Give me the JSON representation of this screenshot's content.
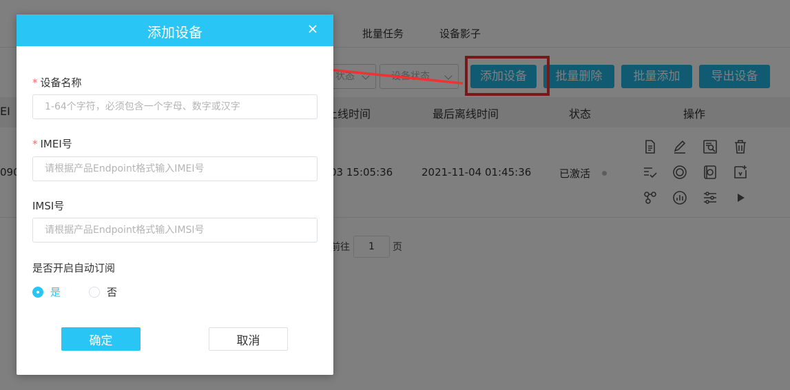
{
  "tabs": [
    "批量任务",
    "设备影子"
  ],
  "filters": {
    "partial_select": "状态",
    "status_select": "设备状态"
  },
  "toolbar": {
    "add_device": "添加设备",
    "batch_delete": "批量删除",
    "batch_add": "批量添加",
    "export_device": "导出设备"
  },
  "table": {
    "headers": [
      "EI",
      "上线时间",
      "最后离线时间",
      "状态",
      "操作"
    ],
    "row": {
      "imei_partial": "090",
      "online_time": "03 15:05:36",
      "last_offline_time": "2021-11-04 01:45:36",
      "status": "已激活"
    },
    "operation_icons": [
      "document-icon",
      "edit-icon",
      "search-detail-icon",
      "delete-icon",
      "checklist-icon",
      "target-icon",
      "data-icon",
      "star-add-icon",
      "nodes-icon",
      "chart-icon",
      "settings-sliders-icon",
      "play-icon"
    ]
  },
  "pager": {
    "goto_label": "前往",
    "page": "1",
    "page_unit": "页"
  },
  "dialog": {
    "title": "添加设备",
    "device_name_label": "设备名称",
    "device_name_placeholder": "1-64个字符，必须包含一个字母、数字或汉字",
    "imei_label": "IMEI号",
    "imei_placeholder": "请根据产品Endpoint格式输入IMEI号",
    "imsi_label": "IMSI号",
    "imsi_placeholder": "请根据产品Endpoint格式输入IMSI号",
    "auto_subscribe_label": "是否开启自动订阅",
    "option_yes": "是",
    "option_no": "否",
    "confirm_label": "确定",
    "cancel_label": "取消"
  },
  "colors": {
    "accent": "#29c6f5",
    "button": "#23b7e5",
    "annotation_red": "#f03232"
  }
}
